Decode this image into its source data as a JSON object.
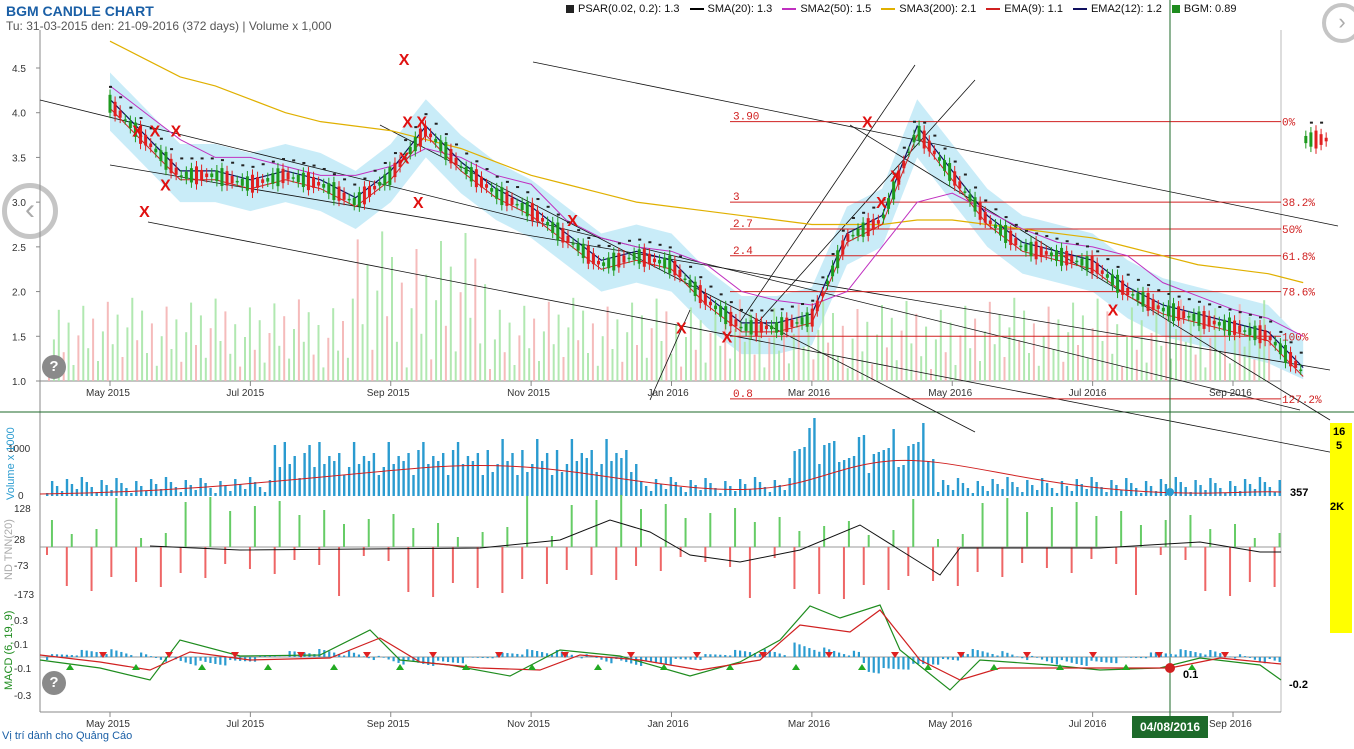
{
  "header": {
    "title": "BGM CANDLE CHART",
    "subtitle": "Tu: 31-03-2015 den: 21-09-2016 (372 days) | Volume x 1,000"
  },
  "legend": [
    {
      "label": "PSAR(0.02, 0.2): 1.3",
      "color": "#222222",
      "kind": "square"
    },
    {
      "label": "SMA(20): 1.3",
      "color": "#000000",
      "kind": "line"
    },
    {
      "label": "SMA2(50): 1.5",
      "color": "#c030c0",
      "kind": "line"
    },
    {
      "label": "SMA3(200): 2.1",
      "color": "#e0b000",
      "kind": "line"
    },
    {
      "label": "EMA(9): 1.1",
      "color": "#d02020",
      "kind": "line"
    },
    {
      "label": "EMA2(12): 1.2",
      "color": "#101060",
      "kind": "line"
    },
    {
      "label": "BGM: 0.89",
      "color": "#1e8c1e",
      "kind": "square"
    }
  ],
  "colors": {
    "up": "#1e9a1e",
    "down": "#e02020",
    "cloud": "#bfe9f7",
    "volume": "#2a9bd0",
    "nn_pos": "#66cc66",
    "nn_neg": "#ee6666",
    "fib": "#d02020",
    "cursor": "#1d6a2a"
  },
  "icons": {
    "nav_left": "chevron-left-icon",
    "nav_right": "chevron-right-icon",
    "help": "question-icon"
  },
  "ui": {
    "help_glyph": "?",
    "nav_left_glyph": "‹",
    "nav_right_glyph": "›",
    "cursor_date": "04/08/2016",
    "ad_text": "Vị trí dành cho Quảng Cáo",
    "yellow_top": "16",
    "yellow_mid": "5",
    "yellow_low": "2K"
  },
  "chart_data": [
    {
      "type": "line",
      "name": "BGM price panel",
      "x_ticks": [
        "May 2015",
        "Jul 2015",
        "Sep 2015",
        "Nov 2015",
        "Jan 2016",
        "Mar 2016",
        "May 2016",
        "Jul 2016",
        "Sep 2016"
      ],
      "y_ticks": [
        "1.0",
        "1.5",
        "2.0",
        "2.5",
        "3.0",
        "3.5",
        "4.0",
        "4.5"
      ],
      "ylim": [
        1.0,
        4.8
      ],
      "x_months": [
        1.0,
        1.5,
        2.0,
        2.5,
        3.0,
        3.5,
        4.0,
        4.5,
        5.0,
        5.5,
        6.0,
        6.5,
        7.0,
        7.5,
        8.0,
        8.5,
        9.0,
        9.5,
        10.0,
        10.5,
        11.0,
        11.5,
        12.0,
        12.5,
        13.0,
        13.5,
        14.0,
        14.5,
        15.0,
        15.5,
        16.0,
        16.5,
        17.0,
        17.5,
        18.0
      ],
      "close": [
        4.1,
        3.7,
        3.3,
        3.3,
        3.2,
        3.3,
        3.2,
        3.0,
        3.3,
        3.8,
        3.4,
        3.1,
        2.9,
        2.6,
        2.3,
        2.4,
        2.3,
        1.9,
        1.6,
        1.6,
        1.7,
        2.6,
        2.8,
        3.8,
        3.3,
        2.8,
        2.5,
        2.4,
        2.3,
        2.0,
        1.8,
        1.7,
        1.6,
        1.5,
        1.1
      ],
      "sma3_200": [
        4.8,
        4.6,
        4.4,
        4.3,
        4.15,
        4.0,
        3.9,
        3.85,
        3.8,
        3.7,
        3.6,
        3.45,
        3.3,
        3.2,
        3.1,
        3.0,
        2.95,
        2.9,
        2.85,
        2.8,
        2.75,
        2.75,
        2.75,
        2.8,
        2.8,
        2.75,
        2.7,
        2.65,
        2.6,
        2.5,
        2.4,
        2.3,
        2.25,
        2.2,
        2.1
      ],
      "sma2_50": [
        4.3,
        4.0,
        3.7,
        3.5,
        3.5,
        3.4,
        3.3,
        3.3,
        3.4,
        3.6,
        3.5,
        3.3,
        3.2,
        2.8,
        2.6,
        2.5,
        2.45,
        2.3,
        2.0,
        1.9,
        1.85,
        2.0,
        2.5,
        3.0,
        3.1,
        2.9,
        2.7,
        2.55,
        2.5,
        2.4,
        2.1,
        1.95,
        1.8,
        1.7,
        1.5
      ],
      "fib_levels": [
        {
          "price": 3.9,
          "label": "3.90",
          "pct": "0%"
        },
        {
          "price": 3.0,
          "label": "3",
          "pct": "38.2%"
        },
        {
          "price": 2.7,
          "label": "2.7",
          "pct": "50%"
        },
        {
          "price": 2.4,
          "label": "2.4",
          "pct": "61.8%"
        },
        {
          "price": 2.0,
          "label": "",
          "pct": "78.6%"
        },
        {
          "price": 1.5,
          "label": "",
          "pct": "100%"
        },
        {
          "price": 0.8,
          "label": "0.8",
          "pct": "127.2%"
        }
      ],
      "signals_x": [
        {
          "month": 1.65,
          "price": 3.8
        },
        {
          "month": 1.95,
          "price": 3.8
        },
        {
          "month": 1.8,
          "price": 3.2
        },
        {
          "month": 1.5,
          "price": 2.9
        },
        {
          "month": 5.25,
          "price": 3.9
        },
        {
          "month": 5.45,
          "price": 3.9
        },
        {
          "month": 5.2,
          "price": 3.5
        },
        {
          "month": 5.4,
          "price": 3.0
        },
        {
          "month": 7.6,
          "price": 2.8
        },
        {
          "month": 1.4,
          "price": 3.8
        },
        {
          "month": 9.15,
          "price": 1.6
        },
        {
          "month": 9.8,
          "price": 1.5
        },
        {
          "month": 11.8,
          "price": 3.9
        },
        {
          "month": 12.2,
          "price": 3.3
        },
        {
          "month": 12.0,
          "price": 3.0
        },
        {
          "month": 15.3,
          "price": 1.8
        },
        {
          "month": 5.2,
          "price": 4.6
        }
      ]
    },
    {
      "type": "bar",
      "name": "Volume x1000",
      "ylabel": "Volume x 1000",
      "y_ticks": [
        "0",
        "1000"
      ],
      "last_label": "357"
    },
    {
      "type": "bar",
      "name": "NN(20)",
      "ylabel": "ND TNN(20)",
      "y_ticks": [
        "128",
        "28",
        "-73",
        "-173"
      ]
    },
    {
      "type": "line",
      "name": "MACD (6, 19, 9)",
      "ylabel": "MACD (6, 19, 9)",
      "y_ticks": [
        "0.3",
        "0.1",
        "-0.1",
        "-0.3"
      ],
      "value_labels": [
        "0.1",
        "-0.2"
      ]
    }
  ]
}
